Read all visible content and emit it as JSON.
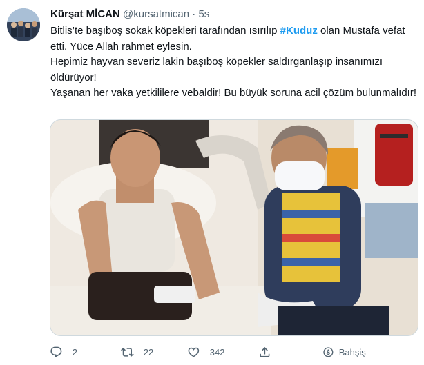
{
  "tweet": {
    "author_name": "Kürşat MİCAN",
    "author_handle": "@kursatmican",
    "separator": "·",
    "timestamp": "5s",
    "text_part1": "Bitlis’te başıboş sokak köpekleri tarafından ısırılıp ",
    "hashtag": "#Kuduz",
    "text_part2": " olan  Mustafa vefat etti. Yüce Allah rahmet eylesin.",
    "line2": "Hepimiz hayvan severiz lakin başıboş köpekler saldırganlaşıp insanımızı öldürüyor!",
    "line3": "Yaşanan her vaka yetkililere vebaldir! Bu büyük soruna acil çözüm bulunmalıdır!"
  },
  "actions": {
    "reply_count": "2",
    "retweet_count": "22",
    "like_count": "342",
    "share_label": "Bahşiş"
  },
  "icons": {
    "reply": "reply-icon",
    "retweet": "retweet-icon",
    "like": "heart-icon",
    "share": "share-icon",
    "tip": "tip-icon"
  },
  "colors": {
    "hashtag": "#1d9bf0",
    "muted": "#536471",
    "text": "#0f1419"
  }
}
